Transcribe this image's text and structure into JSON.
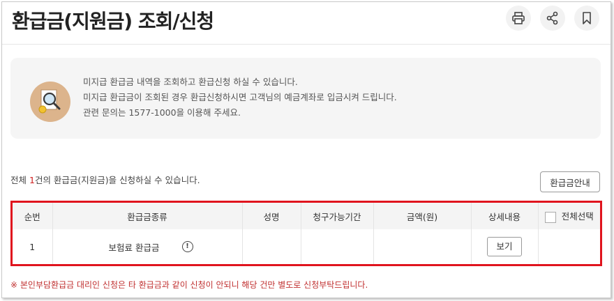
{
  "page": {
    "title": "환급금(지원금) 조회/신청"
  },
  "toolbar": {
    "print_icon": "print-icon",
    "share_icon": "share-icon",
    "bookmark_icon": "bookmark-icon"
  },
  "info_box": {
    "icon": "magnifier-document-icon",
    "lines": [
      "미지급 환급금 내역을 조회하고 환급신청 하실 수 있습니다.",
      "미지급 환급금이 조회된 경우 환급신청하시면 고객님의 예금계좌로 입금시켜 드립니다.",
      "관련 문의는 1577-1000을 이용해 주세요."
    ]
  },
  "summary": {
    "prefix": "전체 ",
    "count": "1",
    "suffix": "건의 환급금(지원금)을 신청하실 수 있습니다."
  },
  "guide_button": {
    "label": "환급금안내"
  },
  "table": {
    "headers": [
      "순번",
      "환급금종류",
      "성명",
      "청구가능기간",
      "금액(원)",
      "상세내용",
      "전체선택"
    ],
    "rows": [
      {
        "no": "1",
        "type": "보험료 환급금",
        "name": "",
        "period": "",
        "amount": "",
        "detail_button": "보기"
      }
    ]
  },
  "notice": "※ 본인부담환급금 대리인 신청은 타 환급금과 같이 신청이 안되니 해당 건만 별도로 신청부탁드립니다.",
  "colors": {
    "accent_red": "#e0141e",
    "notice_red": "#c03030",
    "info_bg": "#f5f5f5",
    "icon_bg": "#dcb48c"
  }
}
